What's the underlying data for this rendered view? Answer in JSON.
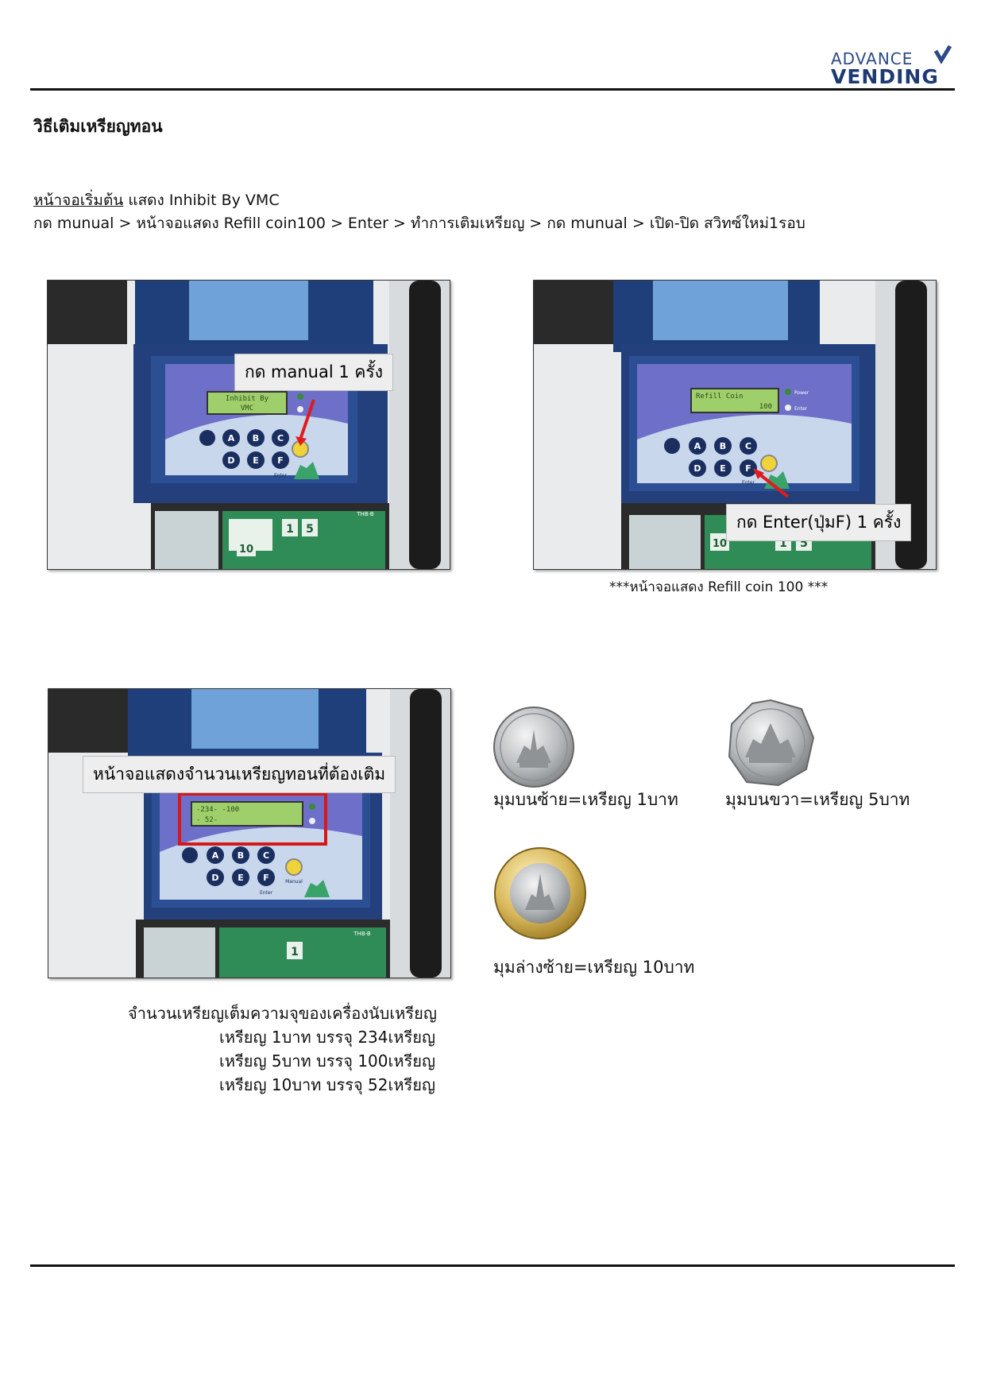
{
  "header": {
    "logo_line1": "ADVANCE",
    "logo_line2": "VENDING",
    "brand_color": "#1e3a73"
  },
  "title": "วิธีเติมเหรียญทอน",
  "instructions": {
    "intro_underlined": "หน้าจอเริ่มต้น",
    "intro_rest": " แสดง Inhibit By VMC",
    "steps": "กด munual > หน้าจอแสดง Refill coin100 > Enter > ทำการเติมเหรียญ > กด munual > เปิด-ปิด สวิทซ์ใหม่1รอบ"
  },
  "photos": {
    "photo1": {
      "callout": "กด manual 1 ครั้ง",
      "lcd_line1": "Inhibit By",
      "lcd_line2": "VMC"
    },
    "photo2": {
      "callout": "กด Enter(ปุ่มF) 1 ครั้ง",
      "caption": "***หน้าจอแสดง Refill coin 100 ***",
      "lcd_line1": "Refill Coin",
      "lcd_line2": "100"
    },
    "photo3": {
      "callout": "หน้าจอแสดงจำนวนเหรียญทอนที่ต้องเติม",
      "lcd_line1": "-234-     -100",
      "lcd_line2": "- 52-"
    },
    "panel": {
      "keys": [
        "A",
        "B",
        "C",
        "D",
        "E",
        "F"
      ],
      "enter_label": "Enter",
      "power_label": "Power",
      "enter_led_label": "Enter",
      "manual_label": "Manual",
      "board_label": "THB-B",
      "board_digits": [
        "1",
        "5",
        "10"
      ]
    }
  },
  "coins": {
    "one": {
      "label": "มุมบนซ้าย=เหรียญ 1บาท"
    },
    "five": {
      "label": "มุมบนขวา=เหรียญ 5บาท"
    },
    "ten": {
      "label": "มุมล่างซ้าย=เหรียญ 10บาท"
    }
  },
  "capacity": {
    "heading": "จำนวนเหรียญเต็มความจุของเครื่องนับเหรียญ",
    "rows": [
      "เหรียญ 1บาท บรรจุ 234เหรียญ",
      "เหรียญ 5บาท บรรจุ 100เหรียญ",
      "เหรียญ 10บาท บรรจุ 52เหรียญ"
    ]
  }
}
